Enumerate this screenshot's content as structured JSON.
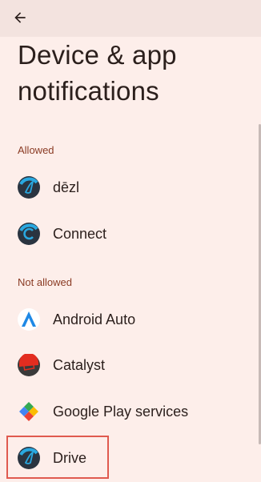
{
  "header": {
    "back_icon": "arrow-back-icon",
    "title": "Device & app notifications"
  },
  "sections": {
    "allowed": {
      "label": "Allowed",
      "apps": [
        {
          "name": "dēzl",
          "icon": "dezl-app-icon"
        },
        {
          "name": "Connect",
          "icon": "connect-app-icon"
        }
      ]
    },
    "not_allowed": {
      "label": "Not allowed",
      "apps": [
        {
          "name": "Android Auto",
          "icon": "android-auto-app-icon"
        },
        {
          "name": "Catalyst",
          "icon": "catalyst-app-icon"
        },
        {
          "name": "Google Play services",
          "icon": "google-play-services-icon"
        },
        {
          "name": "Drive",
          "icon": "drive-app-icon"
        }
      ]
    }
  },
  "colors": {
    "background": "#fdeeea",
    "top_bar": "#f3e3df",
    "section_label": "#8a3b24",
    "highlight": "#e05a4f"
  }
}
